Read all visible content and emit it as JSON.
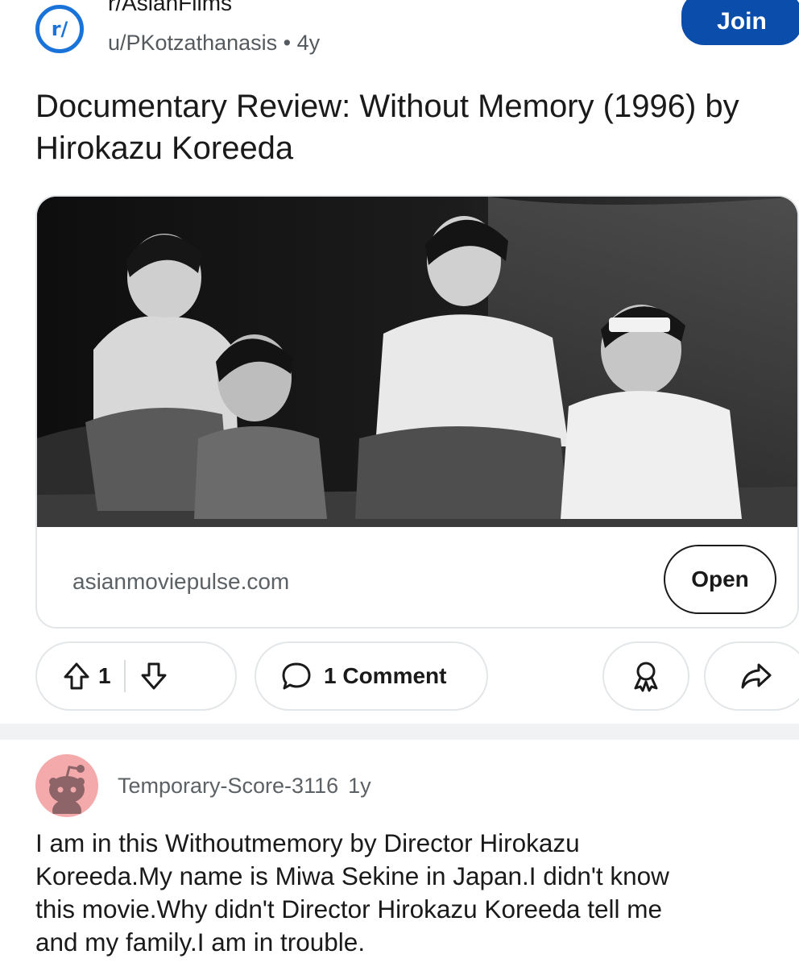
{
  "header": {
    "subreddit": "r/AsianFilms",
    "icon_text": "r/",
    "author": "u/PKotzathanasis",
    "separator": "•",
    "age": "4y",
    "join_label": "Join"
  },
  "post": {
    "title": "Documentary Review: Without Memory (1996) by Hirokazu Koreeda"
  },
  "link_card": {
    "domain": "asianmoviepulse.com",
    "open_label": "Open",
    "image_icon": "black-and-white-family-photo"
  },
  "actions": {
    "upvote_icon": "upvote-arrow-icon",
    "vote_count": "1",
    "downvote_icon": "downvote-arrow-icon",
    "comment_icon": "speech-bubble-icon",
    "comment_label": "1 Comment",
    "award_icon": "award-ribbon-icon",
    "share_icon": "share-arrow-icon"
  },
  "comment": {
    "author": "Temporary-Score-3116",
    "age": "1y",
    "body": "I am in this Withoutmemory by Director Hirokazu\nKoreeda.My name is  Miwa Sekine in Japan.I didn't know\nthis movie.Why didn't Director Hirokazu Koreeda tell me\nand my family.I am in trouble.",
    "avatar_color": "#f4a9ab"
  },
  "colors": {
    "accent": "#0b4dab",
    "subreddit_icon": "#1a73d9",
    "text": "#1a1a1b",
    "meta": "#555a5e"
  }
}
